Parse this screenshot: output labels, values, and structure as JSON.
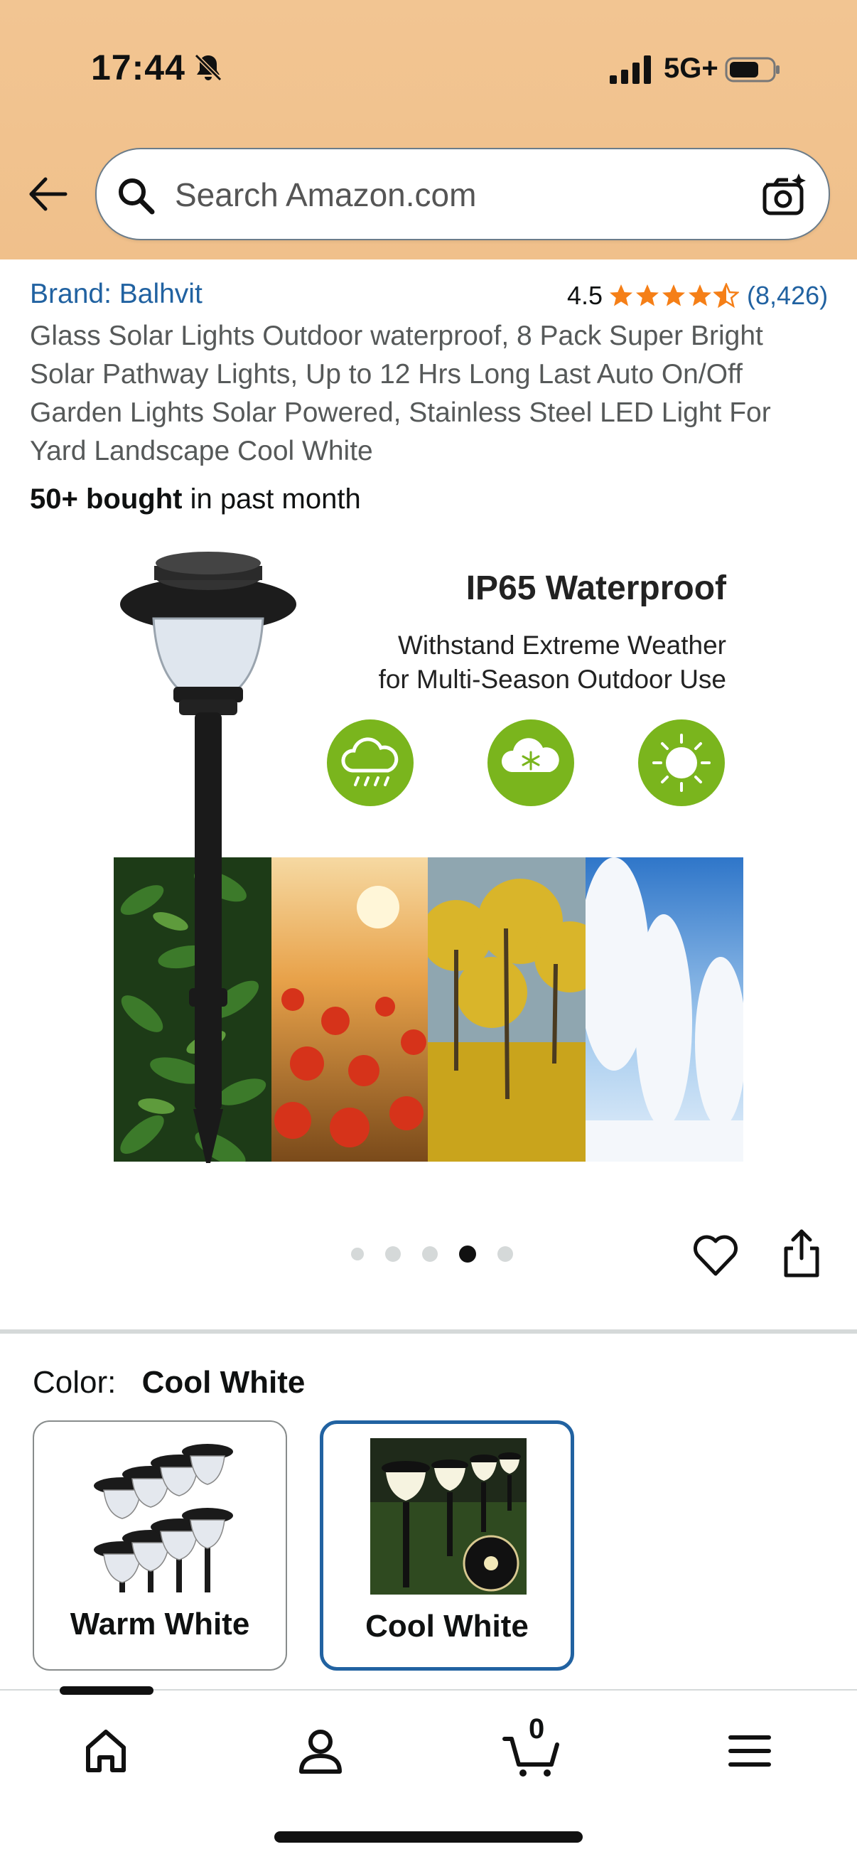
{
  "status_bar": {
    "time": "17:44",
    "network": "5G+",
    "icons": [
      "bell-slash-icon",
      "signal-icon",
      "battery-icon"
    ]
  },
  "search": {
    "placeholder": "Search Amazon.com",
    "icons": [
      "back-arrow-icon",
      "search-icon",
      "camera-icon"
    ]
  },
  "product": {
    "brand": "Brand: Balhvit",
    "rating": "4.5",
    "rating_stars": 4.5,
    "rating_count": "(8,426)",
    "title": "Glass Solar Lights Outdoor waterproof, 8 Pack Super Bright Solar Pathway Lights, Up to 12 Hrs Long Last Auto On/Off Garden Lights Solar Powered, Stainless Steel LED Light For Yard Landscape Cool White",
    "bought_bold": "50+ bought",
    "bought_rest": " in past month"
  },
  "product_image": {
    "heading": "IP65 Waterproof",
    "subline1": "Withstand Extreme Weather",
    "subline2": "for Multi-Season Outdoor Use",
    "weather_icons": [
      "rain-cloud-icon",
      "snow-cloud-icon",
      "sun-icon"
    ],
    "accent_color": "#7ab51d"
  },
  "carousel": {
    "total_images": 5,
    "active_index": 4
  },
  "color_selector": {
    "label": "Color:",
    "selected": "Cool White",
    "options": [
      {
        "label": "Warm White",
        "selected": false
      },
      {
        "label": "Cool White",
        "selected": true
      }
    ],
    "selected_border_color": "#2162a1"
  },
  "bottom_nav": {
    "items": [
      "home-icon",
      "account-icon",
      "cart-icon",
      "menu-icon"
    ],
    "cart_count": "0"
  },
  "colors": {
    "header_bg": "#f2c592",
    "link": "#2162a1",
    "star": "#f57f17"
  }
}
